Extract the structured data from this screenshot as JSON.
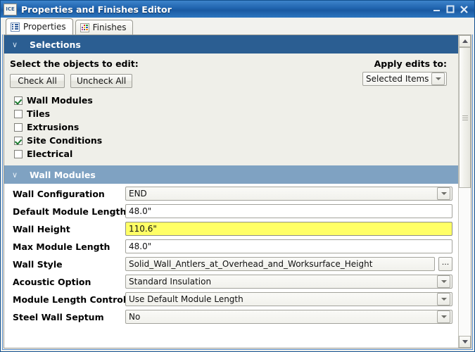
{
  "window": {
    "app_icon_text": "ICE",
    "title": "Properties and Finishes Editor",
    "minimize_label": "–",
    "maximize_label": "□",
    "close_label": "✕"
  },
  "tabs": [
    {
      "label": "Properties",
      "icon": "list-icon",
      "active": true
    },
    {
      "label": "Finishes",
      "icon": "color-swatch-grid-icon",
      "active": false
    }
  ],
  "selections": {
    "header": "Selections",
    "chevron": "∨",
    "instruction": "Select the objects to edit:",
    "check_all_label": "Check All",
    "uncheck_all_label": "Uncheck All",
    "apply_label": "Apply edits to:",
    "apply_value": "Selected Items",
    "items": [
      {
        "label": "Wall Modules",
        "checked": true
      },
      {
        "label": "Tiles",
        "checked": false
      },
      {
        "label": "Extrusions",
        "checked": false
      },
      {
        "label": "Site Conditions",
        "checked": true
      },
      {
        "label": "Electrical",
        "checked": false
      }
    ]
  },
  "wall_modules": {
    "header": "Wall Modules",
    "chevron": "∨",
    "rows": [
      {
        "label": "Wall Configuration",
        "value": "END",
        "type": "combo",
        "highlight": false
      },
      {
        "label": "Default Module Length",
        "value": "48.0\"",
        "type": "text",
        "highlight": false
      },
      {
        "label": "Wall Height",
        "value": "110.6\"",
        "type": "text",
        "highlight": true
      },
      {
        "label": "Max Module Length",
        "value": "48.0\"",
        "type": "text",
        "highlight": false
      },
      {
        "label": "Wall Style",
        "value": "Solid_Wall_Antlers_at_Overhead_and_Worksurface_Height",
        "type": "browse",
        "highlight": false
      },
      {
        "label": "Acoustic Option",
        "value": "Standard Insulation",
        "type": "combo",
        "highlight": false
      },
      {
        "label": "Module Length Control",
        "value": "Use Default Module Length",
        "type": "combo",
        "highlight": false
      },
      {
        "label": "Steel Wall Septum",
        "value": "No",
        "type": "combo",
        "highlight": false
      }
    ],
    "browse_label": "..."
  },
  "scrollbar": {
    "up_label": "scroll-up",
    "down_label": "scroll-down"
  },
  "colors": {
    "titlebar_blue": "#1f63ad",
    "section_dark": "#2b5e92",
    "section_light": "#7fa2c2",
    "highlight_yellow": "#ffff66",
    "check_green": "#1b7a2e"
  },
  "swatch_colors": [
    "#e8e8e8",
    "#e02b2b",
    "#1f9b3c",
    "#7a3f9e",
    "#f2c200",
    "#2f5bb5",
    "#c23fa0",
    "#5a5a5a",
    "#ff8a1f"
  ]
}
